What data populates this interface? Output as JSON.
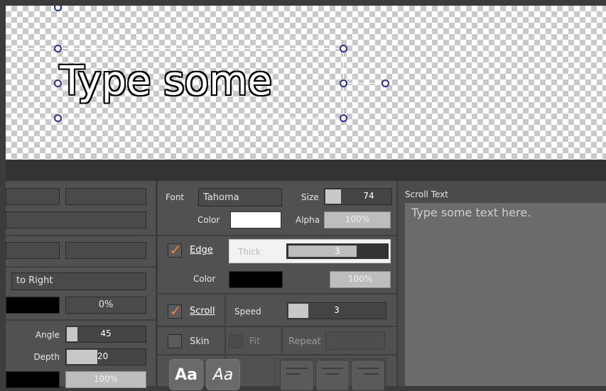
{
  "preview": {
    "text": "Type some",
    "checker_colors": [
      "#ffffff",
      "#c9c9c9"
    ]
  },
  "left_panel": {
    "direction_value": "to Right",
    "gradient_percent": "0%",
    "angle_label": "Angle",
    "angle_value": "45",
    "angle_level_percent": 15,
    "depth_label": "Depth",
    "depth_value": "20",
    "depth_level_percent": 40,
    "opacity_value": "100%"
  },
  "font_section": {
    "font_label": "Font",
    "font_value": "Tahoma",
    "size_label": "Size",
    "size_value": "74",
    "size_level_percent": 25,
    "color_label": "Color",
    "color_value": "#ffffff",
    "alpha_label": "Alpha",
    "alpha_value": "100%"
  },
  "edge_section": {
    "checked": true,
    "label": "Edge",
    "thick_label": "Thick",
    "thick_value": "3",
    "thick_level_percent": 70,
    "color_label": "Color",
    "color_value": "#000000",
    "alpha_value": "100%"
  },
  "scroll_section": {
    "checked": true,
    "label": "Scroll",
    "speed_label": "Speed",
    "speed_value": "3",
    "speed_level_percent": 22,
    "skin_label": "Skin",
    "fit_label": "Fit",
    "repeat_label": "Repeat",
    "style_bold_label": "Aa",
    "style_italic_label": "Aa"
  },
  "scroll_text": {
    "title": "Scroll Text",
    "content": "Type some text here."
  },
  "colors": {
    "accent_check": "#f07f3f",
    "panel_bg": "#515151",
    "dark_bar": "#333333"
  }
}
